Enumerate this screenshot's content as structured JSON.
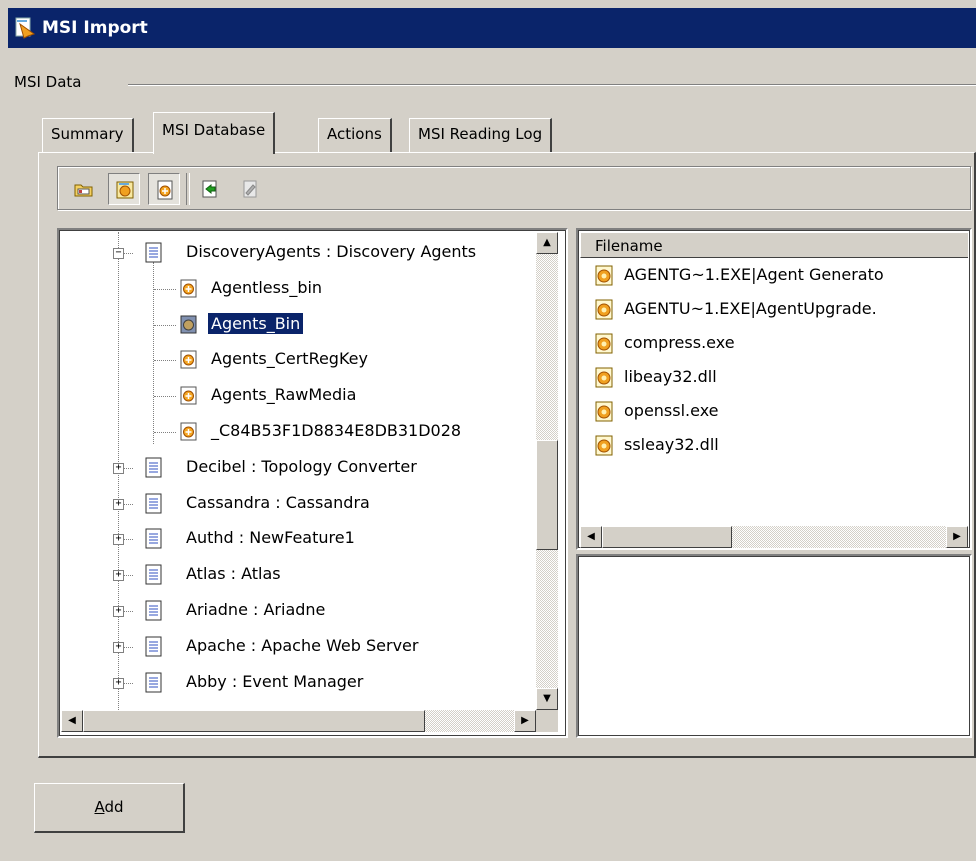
{
  "window": {
    "title": "MSI Import",
    "icon": "msi-import-icon"
  },
  "group": {
    "label": "MSI Data"
  },
  "tabs": [
    {
      "label": "Summary",
      "active": false
    },
    {
      "label": "MSI Database",
      "active": true
    },
    {
      "label": "Actions",
      "active": false
    },
    {
      "label": "MSI Reading Log",
      "active": false
    }
  ],
  "toolbar": {
    "buttons": [
      {
        "icon": "open-database-icon",
        "pressed": false
      },
      {
        "icon": "components-icon",
        "pressed": true
      },
      {
        "icon": "files-icon",
        "pressed": true
      },
      {
        "icon": "export-icon",
        "pressed": false
      },
      {
        "icon": "properties-icon",
        "pressed": false
      }
    ]
  },
  "tree": {
    "items": [
      {
        "label": "DiscoveryAgents : Discovery Agents",
        "level": 1,
        "type": "feature",
        "expander": "-"
      },
      {
        "label": "Agentless_bin",
        "level": 2,
        "type": "component"
      },
      {
        "label": "Agents_Bin",
        "level": 2,
        "type": "component-selected",
        "selected": true
      },
      {
        "label": "Agents_CertRegKey",
        "level": 2,
        "type": "component"
      },
      {
        "label": "Agents_RawMedia",
        "level": 2,
        "type": "component"
      },
      {
        "label": "_C84B53F1D8834E8DB31D028",
        "level": 2,
        "type": "component"
      },
      {
        "label": "Decibel : Topology Converter",
        "level": 1,
        "type": "feature",
        "expander": "+"
      },
      {
        "label": "Cassandra : Cassandra",
        "level": 1,
        "type": "feature",
        "expander": "+"
      },
      {
        "label": "Authd : NewFeature1",
        "level": 1,
        "type": "feature",
        "expander": "+"
      },
      {
        "label": "Atlas : Atlas",
        "level": 1,
        "type": "feature",
        "expander": "+"
      },
      {
        "label": "Ariadne : Ariadne",
        "level": 1,
        "type": "feature",
        "expander": "+"
      },
      {
        "label": "Apache : Apache Web Server",
        "level": 1,
        "type": "feature",
        "expander": "+"
      },
      {
        "label": "Abby : Event Manager",
        "level": 1,
        "type": "feature",
        "expander": "+"
      }
    ]
  },
  "files": {
    "column": "Filename",
    "rows": [
      "AGENTG~1.EXE|Agent Generato",
      "AGENTU~1.EXE|AgentUpgrade.",
      "compress.exe",
      "libeay32.dll",
      "openssl.exe",
      "ssleay32.dll"
    ]
  },
  "buttons": {
    "add": "Add"
  }
}
